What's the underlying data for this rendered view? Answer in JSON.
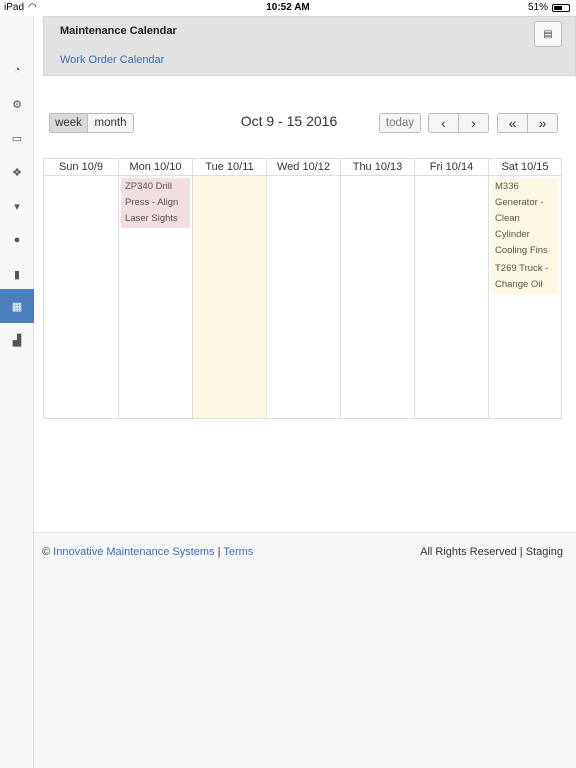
{
  "status_bar": {
    "device": "iPad",
    "time": "10:52 AM",
    "battery": "51%"
  },
  "sidebar": {
    "items": [
      {
        "icon": "dashboard-icon",
        "glyph": "◔"
      },
      {
        "icon": "gears-icon",
        "glyph": "⚙"
      },
      {
        "icon": "document-icon",
        "glyph": "▭"
      },
      {
        "icon": "cubes-icon",
        "glyph": "❖"
      },
      {
        "icon": "cart-icon",
        "glyph": "▾"
      },
      {
        "icon": "user-icon",
        "glyph": "●"
      },
      {
        "icon": "building-icon",
        "glyph": "▮"
      },
      {
        "icon": "calendar-icon",
        "glyph": "▦",
        "active": true
      },
      {
        "icon": "bar-chart-icon",
        "glyph": "▟"
      }
    ]
  },
  "header": {
    "title": "Maintenance Calendar",
    "breadcrumb": "Work Order Calendar",
    "pdf_icon": "pdf-icon"
  },
  "toolbar": {
    "week_label": "week",
    "month_label": "month",
    "range_title": "Oct 9 - 15 2016",
    "today_label": "today",
    "prev_label": "‹",
    "next_label": "›",
    "prev_year_label": "«",
    "next_year_label": "»"
  },
  "calendar": {
    "days": [
      {
        "label": "Sun 10/9",
        "events": []
      },
      {
        "label": "Mon 10/10",
        "events": [
          {
            "text": "ZP340 Drill Press - Align Laser Sights",
            "color": "#f2dede"
          }
        ]
      },
      {
        "label": "Tue 10/11",
        "today": true,
        "events": []
      },
      {
        "label": "Wed 10/12",
        "events": []
      },
      {
        "label": "Thu 10/13",
        "events": []
      },
      {
        "label": "Fri 10/14",
        "events": []
      },
      {
        "label": "Sat 10/15",
        "events": [
          {
            "text": "M336 Generator - Clean Cylinder Cooling Fins",
            "color": "#fcf8e3"
          },
          {
            "text": "T269 Truck - Change Oil",
            "color": "#fcf8e3"
          }
        ]
      }
    ]
  },
  "footer": {
    "copyright": "©",
    "company_link": "Innovative Maintenance Systems",
    "separator": "|",
    "terms_link": "Terms",
    "rights": "All Rights Reserved | Staging"
  }
}
